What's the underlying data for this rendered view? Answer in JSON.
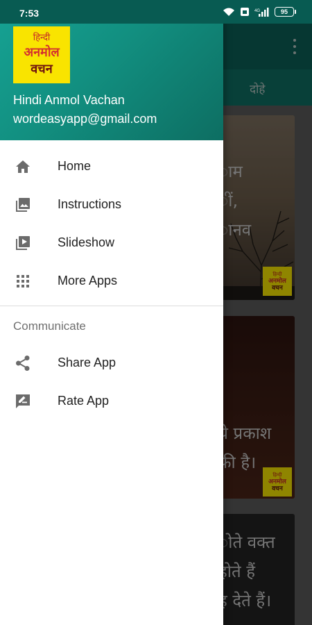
{
  "status_bar": {
    "time": "7:53",
    "battery": "95"
  },
  "drawer": {
    "logo_lines": [
      "हिन्दी",
      "अनमोल",
      "वचन"
    ],
    "app_name": "Hindi Anmol Vachan",
    "email": "wordeasyapp@gmail.com",
    "items": [
      {
        "label": "Home",
        "icon": "home-icon"
      },
      {
        "label": "Instructions",
        "icon": "image-library-icon"
      },
      {
        "label": "Slideshow",
        "icon": "slideshow-icon"
      },
      {
        "label": "More Apps",
        "icon": "apps-grid-icon"
      }
    ],
    "section_title": "Communicate",
    "communicate_items": [
      {
        "label": "Share App",
        "icon": "share-icon"
      },
      {
        "label": "Rate App",
        "icon": "rate-review-icon"
      }
    ]
  },
  "background": {
    "tab_label": "दोहे",
    "card1_lines": [
      "ाम",
      "ीं,",
      "ानव"
    ],
    "card2_lines": [
      "ये प्रकाश",
      "फ़ी है।"
    ],
    "card3_lines": [
      "ोते वक्त",
      "होते हैं",
      "ह देते हैं।"
    ],
    "card_logo_lines": [
      "हिन्दी",
      "अनमोल",
      "वचन"
    ]
  },
  "colors": {
    "primary": "#0f6e63",
    "header_gradient_start": "#16a394",
    "logo_yellow": "#f9e400",
    "logo_red": "#d32f2f"
  }
}
